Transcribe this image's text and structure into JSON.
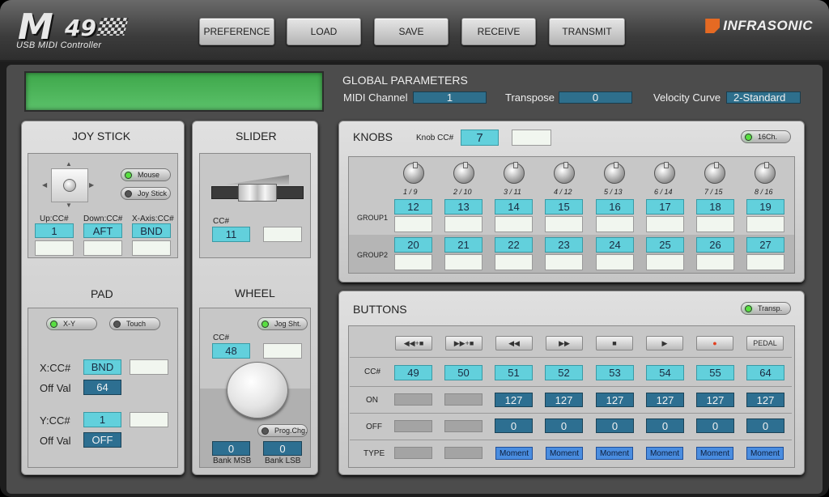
{
  "header": {
    "logo_main": "M",
    "logo_number": "49",
    "logo_subtitle": "USB MIDI Controller",
    "buttons": [
      "PREFERENCE",
      "LOAD",
      "SAVE",
      "RECEIVE",
      "TRANSMIT"
    ],
    "brand": "INFRASONIC"
  },
  "global": {
    "title": "GLOBAL PARAMETERS",
    "midi_channel_label": "MIDI Channel",
    "midi_channel": "1",
    "transpose_label": "Transpose",
    "transpose": "0",
    "velocity_label": "Velocity Curve",
    "velocity": "2-Standard"
  },
  "joystick": {
    "title": "JOY STICK",
    "mode_mouse": "Mouse",
    "mode_joystick": "Joy Stick",
    "up_label": "Up:CC#",
    "up_value": "1",
    "down_label": "Down:CC#",
    "down_value": "AFT",
    "xaxis_label": "X-Axis:CC#",
    "xaxis_value": "BND"
  },
  "pad": {
    "title": "PAD",
    "mode_xy": "X-Y",
    "mode_touch": "Touch",
    "x_label": "X:CC#",
    "x_value": "BND",
    "x_off_label": "Off Val",
    "x_off_value": "64",
    "y_label": "Y:CC#",
    "y_value": "1",
    "y_off_label": "Off Val",
    "y_off_value": "OFF"
  },
  "slider": {
    "title": "SLIDER",
    "cc_label": "CC#",
    "cc_value": "11"
  },
  "wheel": {
    "title": "WHEEL",
    "jog_label": "Jog Sht.",
    "cc_label": "CC#",
    "cc_value": "48",
    "prog_label": "Prog.Chg.",
    "bank_msb_value": "0",
    "bank_msb_label": "Bank MSB",
    "bank_lsb_value": "0",
    "bank_lsb_label": "Bank LSB"
  },
  "knobs": {
    "title": "KNOBS",
    "knob_cc_label": "Knob CC#",
    "knob_cc_value": "7",
    "ch16_label": "16Ch.",
    "numbers": [
      {
        "a": "1",
        "b": "9"
      },
      {
        "a": "2",
        "b": "10"
      },
      {
        "a": "3",
        "b": "11"
      },
      {
        "a": "4",
        "b": "12"
      },
      {
        "a": "5",
        "b": "13"
      },
      {
        "a": "6",
        "b": "14"
      },
      {
        "a": "7",
        "b": "15"
      },
      {
        "a": "8",
        "b": "16"
      }
    ],
    "group1_label": "GROUP1",
    "group1": [
      "12",
      "13",
      "14",
      "15",
      "16",
      "17",
      "18",
      "19"
    ],
    "group2_label": "GROUP2",
    "group2": [
      "20",
      "21",
      "22",
      "23",
      "24",
      "25",
      "26",
      "27"
    ]
  },
  "buttons": {
    "title": "BUTTONS",
    "transp_label": "Transp.",
    "transport_icons": [
      "rewind-minus-icon",
      "forward-plus-icon",
      "rewind-icon",
      "fast-forward-icon",
      "stop-icon",
      "play-icon",
      "record-icon"
    ],
    "pedal_label": "PEDAL",
    "cc_row_label": "CC#",
    "cc": [
      "49",
      "50",
      "51",
      "52",
      "53",
      "54",
      "55",
      "64"
    ],
    "on_row_label": "ON",
    "on": [
      "",
      "",
      "127",
      "127",
      "127",
      "127",
      "127",
      "127"
    ],
    "off_row_label": "OFF",
    "off": [
      "",
      "",
      "0",
      "0",
      "0",
      "0",
      "0",
      "0"
    ],
    "type_row_label": "TYPE",
    "type": [
      "",
      "",
      "Moment",
      "Moment",
      "Moment",
      "Moment",
      "Moment",
      "Moment"
    ]
  },
  "colors": {
    "lcd": "#4bb85a",
    "value_field": "#62d0dc",
    "param_field": "#2d6f91",
    "type_field": "#4a8de0",
    "led_on": "#57e040"
  }
}
